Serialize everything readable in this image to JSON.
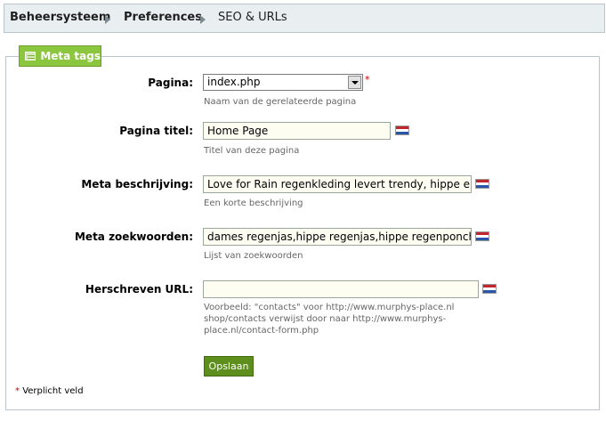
{
  "breadcrumb": {
    "items": [
      "Beheersysteem",
      "Preferences",
      "SEO & URLs"
    ]
  },
  "section": {
    "title": "Meta tags"
  },
  "form": {
    "pagina": {
      "label": "Pagina:",
      "value": "index.php",
      "hint": "Naam van de gerelateerde pagina",
      "required_marker": "*"
    },
    "pagina_titel": {
      "label": "Pagina titel:",
      "value": "Home Page",
      "hint": "Titel van deze pagina"
    },
    "meta_beschrijving": {
      "label": "Meta beschrijving:",
      "value": "Love for Rain regenkleding levert trendy, hippe en uniek",
      "hint": "Een korte beschrijving"
    },
    "meta_zoekwoorden": {
      "label": "Meta zoekwoorden:",
      "value": "dames regenjas,hippe regenjas,hippe regenponcho,tran",
      "hint": "Lijst van zoekwoorden"
    },
    "herschreven_url": {
      "label": "Herschreven URL:",
      "value": "",
      "hint_lines": [
        "Voorbeeld: \"contacts\" voor http://www.murphys-place.nl",
        "shop/contacts verwijst door naar http://www.murphys-",
        "place.nl/contact-form.php"
      ]
    },
    "save_label": "Opslaan",
    "required_note": "Verplicht veld",
    "required_star": "*"
  },
  "icons": {
    "flag": "dutch-flag-icon",
    "section": "keyboard-icon",
    "separator": "chevron-right-icon"
  },
  "colors": {
    "accent_green": "#8cc63f",
    "button_green": "#5e8f1d",
    "required_red": "#cc0000"
  }
}
